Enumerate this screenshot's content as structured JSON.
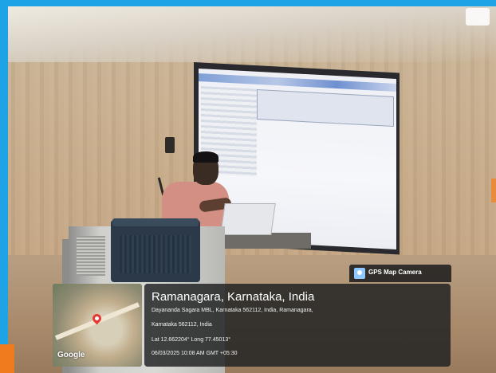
{
  "gps_overlay": {
    "app_label": "GPS Map Camera",
    "location_title": "Ramanagara, Karnataka, India",
    "address_line1": "Dayananda Sagara MBL, Karnataka 562112, India, Ramanagara,",
    "address_line2": "Karnataka 562112, India",
    "lat_long": "Lat 12.662204° Long 77.45013°",
    "datetime": "06/03/2025 10:08 AM GMT +05:30"
  },
  "map_thumbnail": {
    "provider_logo": "Google",
    "pin_color": "#e53935"
  },
  "icons": {
    "app_icon": "map-camera-icon",
    "pin_icon": "location-pin-icon"
  }
}
